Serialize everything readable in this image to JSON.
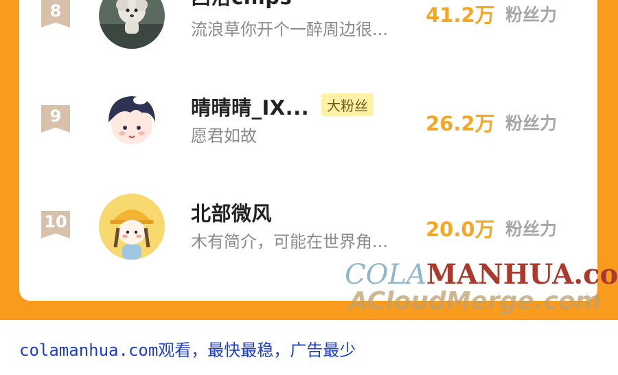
{
  "ranking": [
    {
      "rank": "8",
      "name": "西洛chips",
      "bio": "流浪草你开个一醉周边很...",
      "fans": "41.2万",
      "fans_label": "粉丝力",
      "badge": null
    },
    {
      "rank": "9",
      "name": "晴晴晴_IX...",
      "bio": "愿君如故",
      "fans": "26.2万",
      "fans_label": "粉丝力",
      "badge": "大粉丝"
    },
    {
      "rank": "10",
      "name": "北部微风",
      "bio": "木有简介，可能在世界角...",
      "fans": "20.0万",
      "fans_label": "粉丝力",
      "badge": null
    }
  ],
  "watermark": {
    "line1_light": "COLA",
    "line1_bold": "MANHUA.com",
    "line2": "ACloudMerge.com"
  },
  "footer_text": "colamanhua.com观看，最快最稳，广告最少",
  "colors": {
    "frame": "#f99b1d",
    "fans_value": "#f5a623",
    "rank_badge": "#d8c0ab",
    "footer_link": "#1e3ed0"
  }
}
